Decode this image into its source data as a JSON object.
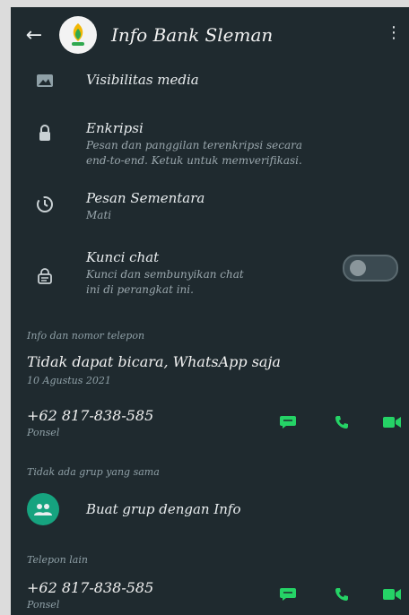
{
  "header": {
    "title": "Info Bank Sleman"
  },
  "settings": [
    {
      "title": "Visibilitas media",
      "icon": "image-icon"
    },
    {
      "title": "Enkripsi",
      "subtitle": "Pesan dan panggilan terenkripsi secara\nend-to-end. Ketuk untuk memverifikasi.",
      "icon": "lock-icon"
    },
    {
      "title": "Pesan Sementara",
      "subtitle": "Mati",
      "icon": "timer-icon"
    },
    {
      "title": "Kunci chat",
      "subtitle": "Kunci dan sembunyikan chat\nini di perangkat ini.",
      "icon": "chat-lock-icon",
      "toggle_on": false
    }
  ],
  "info_section": {
    "label": "Info dan nomor telepon",
    "about": "Tidak dapat bicara, WhatsApp saja",
    "about_date": "10 Agustus 2021",
    "phone": "+62 817-838-585",
    "phone_type": "Ponsel"
  },
  "groups": {
    "label": "Tidak ada grup yang sama",
    "create_label": "Buat grup dengan Info"
  },
  "other_phone": {
    "label": "Telepon lain",
    "phone": "+62 817-838-585",
    "phone_type": "Ponsel"
  },
  "colors": {
    "accent": "#25d366",
    "background": "#1f2a2f"
  }
}
